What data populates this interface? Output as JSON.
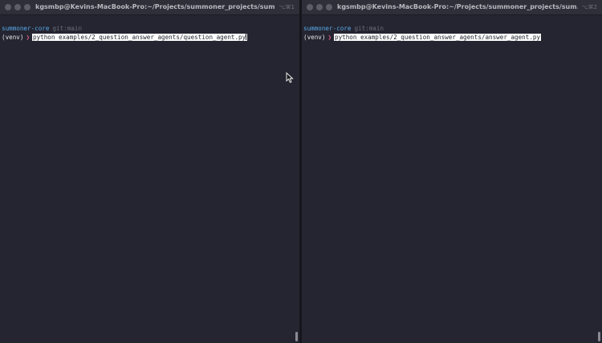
{
  "left_terminal": {
    "title": "kgsmbp@Kevins-MacBook-Pro:~/Projects/summoner_projects/summ...",
    "shortcut": "⌥⌘1",
    "directory": "summoner-core",
    "git_branch": "git:main",
    "env": "(venv)",
    "command": "python examples/2_question_answer_agents/question_agent.py"
  },
  "right_terminal": {
    "title": "kgsmbp@Kevins-MacBook-Pro:~/Projects/summoner_projects/sum...",
    "shortcut": "⌥⌘2",
    "directory": "summoner-core",
    "git_branch": "git:main",
    "env": "(venv)",
    "command": "python examples/2_question_answer_agents/answer_agent.py"
  },
  "prompt_symbol": "❯",
  "colors": {
    "background": "#242530",
    "titlebar": "#2e2f38",
    "directory": "#5aa8ea",
    "prompt_arrow": "#e05c8a",
    "selection": "#ffffff"
  }
}
